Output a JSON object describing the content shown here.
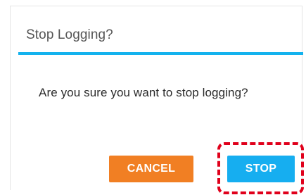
{
  "dialog": {
    "title": "Stop Logging?",
    "message": "Are you sure you want to stop logging?",
    "cancel_label": "CANCEL",
    "stop_label": "STOP"
  },
  "colors": {
    "accent": "#13b2ee",
    "cancel": "#f17f23",
    "stop": "#16aef0",
    "highlight": "#e0001b"
  }
}
